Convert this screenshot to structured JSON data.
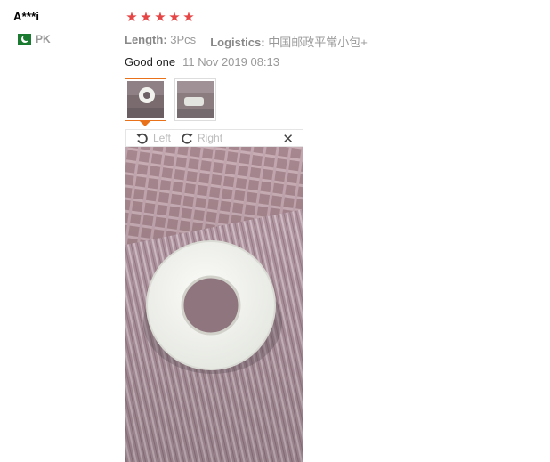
{
  "reviewer": {
    "name": "A***i",
    "country_code": "PK",
    "flag_icon": "pakistan-flag-icon"
  },
  "rating": {
    "stars": 5,
    "max": 5,
    "star_char": "★",
    "color": "#e64545"
  },
  "attributes": [
    {
      "key": "Length:",
      "value": "3Pcs"
    },
    {
      "key": "Logistics:",
      "value": "中国邮政平常小包+"
    }
  ],
  "review": {
    "text": "Good one",
    "date": "11 Nov 2019 08:13"
  },
  "thumbnails": [
    {
      "name": "photo-thumbnail-1",
      "selected": true
    },
    {
      "name": "photo-thumbnail-2",
      "selected": false
    }
  ],
  "viewer": {
    "rotate_left_label": "Left",
    "rotate_right_label": "Right",
    "close_symbol": "✕",
    "accent_color": "#e8711a"
  }
}
